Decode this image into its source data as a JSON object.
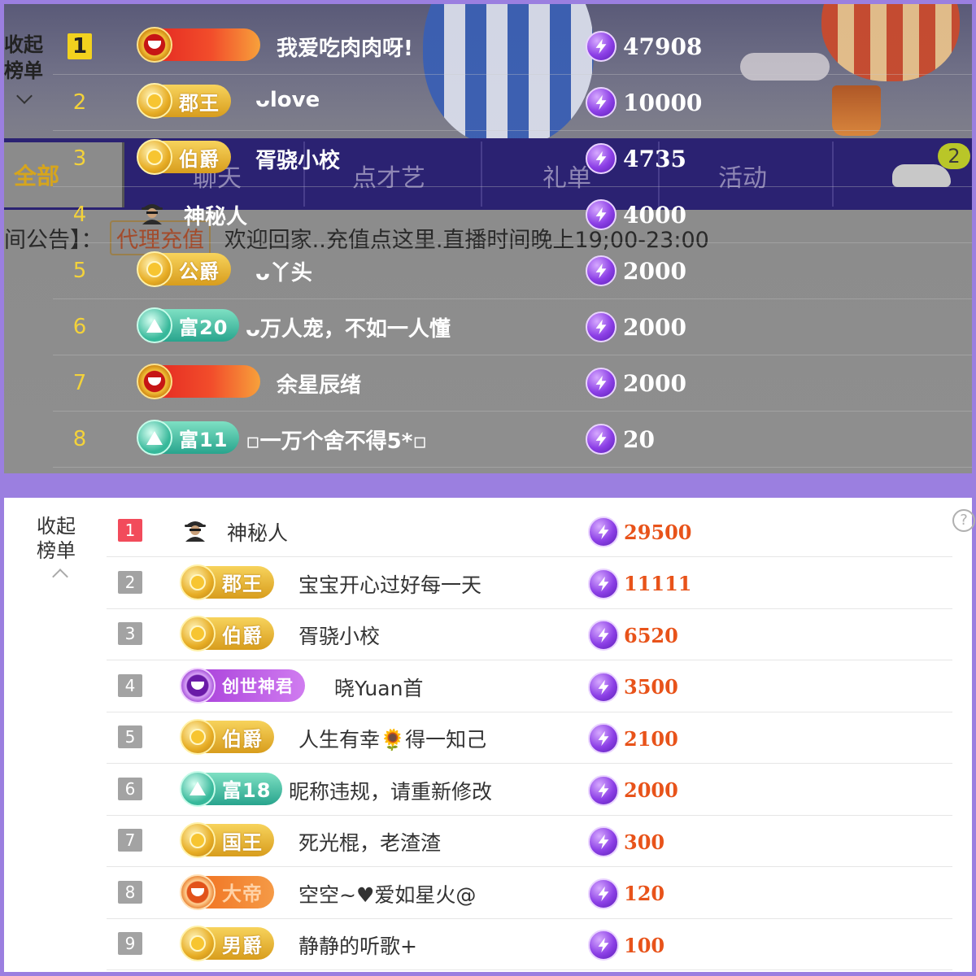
{
  "top_panel": {
    "collapse": {
      "line1": "收起",
      "line2": "榜单"
    },
    "nav": {
      "all_tab": "全部",
      "tabs": [
        "聊天",
        "点才艺",
        "礼单",
        "活动"
      ],
      "badge_count": "2"
    },
    "notice": {
      "prefix": "间公告】：",
      "link": "代理充值",
      "text": "欢迎回家..充值点这里.直播时间晚上19;00-23:00"
    },
    "rows": [
      {
        "rank": "1",
        "badge_type": "redgold",
        "badge_label": "",
        "name": "我爱吃肉肉呀!",
        "score": "47908"
      },
      {
        "rank": "2",
        "badge_type": "gold",
        "badge_label": "郡王",
        "name": "ᴗlove",
        "score": "10000"
      },
      {
        "rank": "3",
        "badge_type": "gold",
        "badge_label": "伯爵",
        "name": "胥骁小校",
        "score": "4735"
      },
      {
        "rank": "4",
        "badge_type": "mystery",
        "badge_label": "",
        "name": "神秘人",
        "score": "4000"
      },
      {
        "rank": "5",
        "badge_type": "gold",
        "badge_label": "公爵",
        "name": "ᴗ丫头",
        "score": "2000"
      },
      {
        "rank": "6",
        "badge_type": "teal",
        "badge_label": "富20",
        "name": "ᴗ万人宠，不如一人懂",
        "score": "2000"
      },
      {
        "rank": "7",
        "badge_type": "redgold",
        "badge_label": "",
        "name": "余星辰绪",
        "score": "2000"
      },
      {
        "rank": "8",
        "badge_type": "teal",
        "badge_label": "富11",
        "name": "▫一万个舍不得5*▫",
        "score": "20"
      }
    ]
  },
  "bottom_panel": {
    "collapse": {
      "line1": "收起",
      "line2": "榜单"
    },
    "help": "?",
    "rows": [
      {
        "rank": "1",
        "badge_type": "mystery",
        "badge_label": "",
        "name": "神秘人",
        "score": "29500"
      },
      {
        "rank": "2",
        "badge_type": "gold",
        "badge_label": "郡王",
        "name": "宝宝开心过好每一天",
        "score": "11111"
      },
      {
        "rank": "3",
        "badge_type": "gold",
        "badge_label": "伯爵",
        "name": "胥骁小校",
        "score": "6520"
      },
      {
        "rank": "4",
        "badge_type": "purple",
        "badge_label": "创世神君",
        "name": "晓Yuan首",
        "score": "3500"
      },
      {
        "rank": "5",
        "badge_type": "gold",
        "badge_label": "伯爵",
        "name": "人生有幸🌻得一知己",
        "score": "2100"
      },
      {
        "rank": "6",
        "badge_type": "teal",
        "badge_label": "富18",
        "name": "昵称违规，请重新修改",
        "score": "2000"
      },
      {
        "rank": "7",
        "badge_type": "gold",
        "badge_label": "国王",
        "name": "死光棍，老渣渣",
        "score": "300"
      },
      {
        "rank": "8",
        "badge_type": "orange",
        "badge_label": "大帝",
        "name": "空空~♥爱如星火@",
        "score": "120"
      },
      {
        "rank": "9",
        "badge_type": "gold",
        "badge_label": "男爵",
        "name": "静静的听歌+",
        "score": "100"
      }
    ]
  },
  "colors": {
    "frame": "#9b7fe0",
    "rank_top": "#f3d23a",
    "rank_first_top": "#f2d21e",
    "rank_first_bottom": "#f24b5b",
    "score_bottom": "#e8531a"
  },
  "icons": {
    "score": "lightning-coin-icon",
    "mystery": "mystery-person-icon",
    "car": "car-icon",
    "help": "question-icon"
  }
}
